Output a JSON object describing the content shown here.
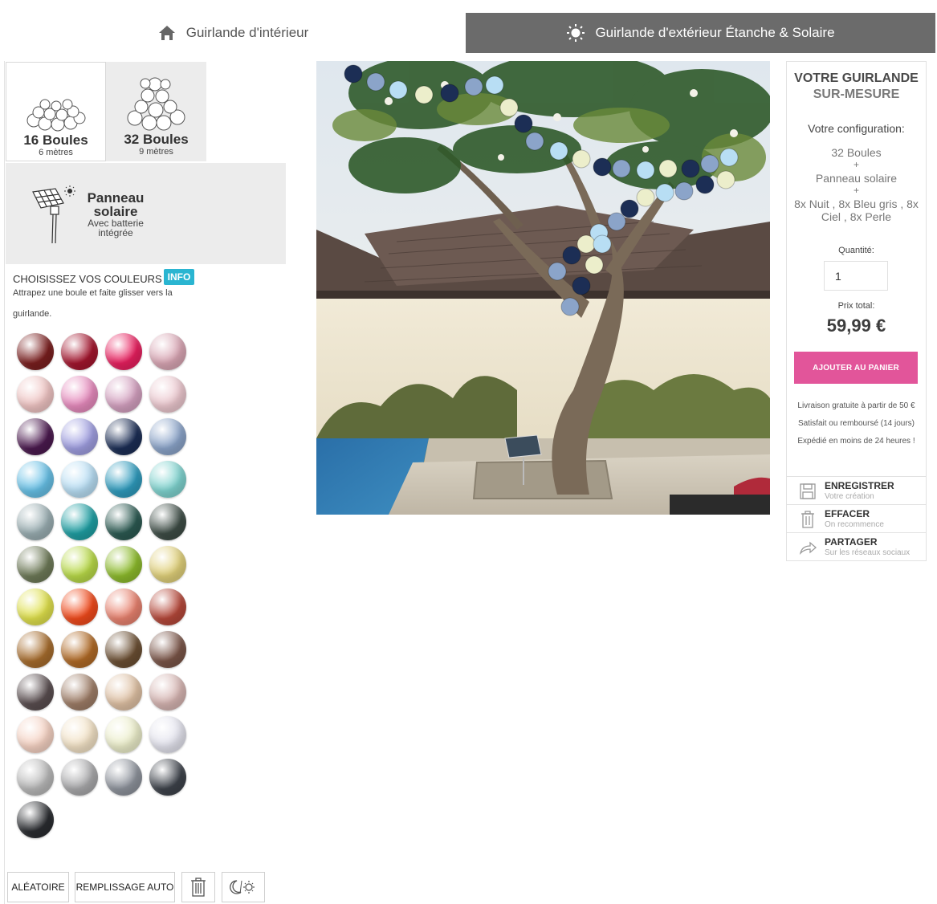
{
  "tabs": {
    "indoor": "Guirlande d'intérieur",
    "outdoor": "Guirlande d'extérieur Étanche & Solaire"
  },
  "options": {
    "balls16": {
      "title": "16 Boules",
      "sub": "6 mètres"
    },
    "balls32": {
      "title": "32 Boules",
      "sub": "9 mètres"
    },
    "solar": {
      "title_line1": "Panneau",
      "title_line2": "solaire",
      "sub_line1": "Avec batterie",
      "sub_line2": "intégrée"
    }
  },
  "colors": {
    "title": "CHOISISSEZ VOS COULEURS",
    "required": "*",
    "info": "INFO",
    "hint": "Attrapez une boule et faite glisser vers la guirlande.",
    "palette": [
      "#7a1f1f",
      "#a3162e",
      "#e8205f",
      "#d9a6b4",
      "#efc4c3",
      "#e68bbd",
      "#d4a1c0",
      "#ecc8cf",
      "#4b1a4f",
      "#9f9ee0",
      "#1c2e55",
      "#8ba4c9",
      "#67c0e6",
      "#b8def4",
      "#2f9bbd",
      "#7fd3cf",
      "#9aaeb2",
      "#1f9fa3",
      "#2c5a52",
      "#3e4d46",
      "#6e7a58",
      "#b8d948",
      "#8dbb2c",
      "#e0d07a",
      "#dfe04c",
      "#f04a1c",
      "#e8826f",
      "#b5483a",
      "#a66c2d",
      "#b06a26",
      "#6b4f33",
      "#7a5548",
      "#5a4e50",
      "#9e7d67",
      "#dfc1a4",
      "#d6b5b2",
      "#f5d2c3",
      "#f2e2c6",
      "#eceecb",
      "#e4e4ee",
      "#b8b8b8",
      "#a9a9ab",
      "#8e939c",
      "#3e434b",
      "#2a2c30"
    ]
  },
  "buttons": {
    "random": "ALÉATOIRE",
    "autofill": "REMPLISSAGE AUTO"
  },
  "summary": {
    "heading1": "VOTRE GUIRLANDE",
    "heading2": "SUR-MESURE",
    "config_label": "Votre configuration:",
    "line1": "32 Boules",
    "plus1": "+",
    "line2": "Panneau solaire",
    "plus2": "+",
    "colors_line1": "8x  Nuit , 8x  Bleu gris , 8x",
    "colors_line2": "Ciel , 8x  Perle",
    "qty_label": "Quantité:",
    "qty_value": "1",
    "price_label": "Prix total:",
    "price": "59,99 €",
    "add_to_cart": "AJOUTER AU PANIER",
    "note1": "Livraison gratuite à partir de 50 €",
    "note2": "Satisfait ou remboursé (14 jours)",
    "note3": "Expédié en moins de 24 heures !"
  },
  "actions": {
    "save": {
      "title": "ENREGISTRER",
      "sub": "Votre création"
    },
    "clear": {
      "title": "EFFACER",
      "sub": "On recommence"
    },
    "share": {
      "title": "PARTAGER",
      "sub": "Sur les réseaux sociaux"
    }
  },
  "garland_colors": [
    "#1c2e55",
    "#8ba4c9",
    "#b8def4",
    "#eceecb"
  ]
}
